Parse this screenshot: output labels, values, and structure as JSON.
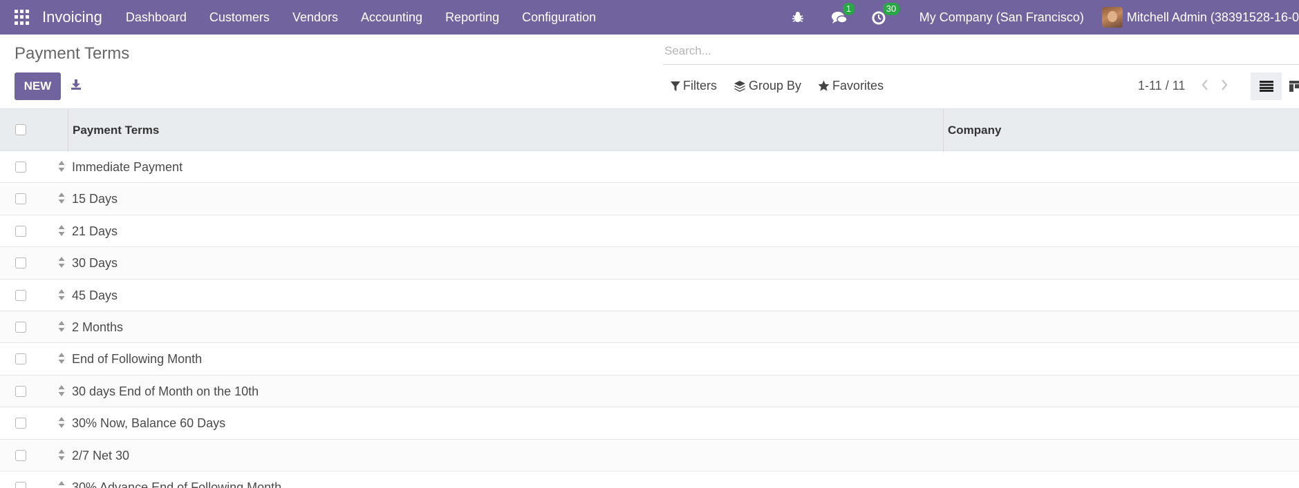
{
  "navbar": {
    "brand": "Invoicing",
    "menu": [
      "Dashboard",
      "Customers",
      "Vendors",
      "Accounting",
      "Reporting",
      "Configuration"
    ],
    "messages_badge": "1",
    "activities_badge": "30",
    "company": "My Company (San Francisco)",
    "user": "Mitchell Admin (38391528-16-0"
  },
  "control": {
    "title": "Payment Terms",
    "new_label": "NEW",
    "search_placeholder": "Search...",
    "filters_label": "Filters",
    "group_by_label": "Group By",
    "favorites_label": "Favorites",
    "pager": "1-11 / 11"
  },
  "table": {
    "columns": [
      "Payment Terms",
      "Company"
    ],
    "rows": [
      "Immediate Payment",
      "15 Days",
      "21 Days",
      "30 Days",
      "45 Days",
      "2 Months",
      "End of Following Month",
      "30 days End of Month on the 10th",
      "30% Now, Balance 60 Days",
      "2/7 Net 30",
      "30% Advance End of Following Month"
    ]
  },
  "colors": {
    "brand": "#71639e",
    "badge": "#28a745",
    "header_bg": "#e9ecef"
  }
}
